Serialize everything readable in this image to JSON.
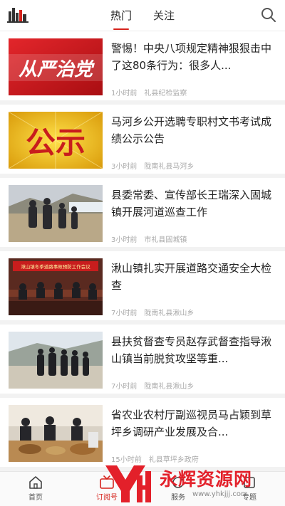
{
  "header": {
    "tabs": [
      {
        "label": "热门",
        "active": true
      },
      {
        "label": "关注",
        "active": false
      }
    ],
    "logo_icon": "city-skyline-icon",
    "search_icon": "search-icon",
    "accent_color": "#d6221b"
  },
  "articles": [
    {
      "title": "警惕！中央八项规定精神狠狠击中了这80条行为：很多人...",
      "time": "1小时前",
      "source": "礼县纪检监察",
      "thumb_text": "从严治党"
    },
    {
      "title": "马河乡公开选聘专职村文书考试成绩公示公告",
      "time": "3小时前",
      "source": "陇南礼县马河乡",
      "thumb_text": "公示"
    },
    {
      "title": "县委常委、宣传部长王瑞深入固城镇开展河道巡查工作",
      "time": "3小时前",
      "source": "市礼县固城镇",
      "thumb_text": ""
    },
    {
      "title": "湫山镇扎实开展道路交通安全大检查",
      "time": "7小时前",
      "source": "陇南礼县湫山乡",
      "thumb_text": "湫山镇冬季道路事故预防工作会议"
    },
    {
      "title": "县扶贫督查专员赵存武督查指导湫山镇当前脱贫攻坚等重...",
      "time": "7小时前",
      "source": "陇南礼县湫山乡",
      "thumb_text": ""
    },
    {
      "title": "省农业农村厅副巡视员马占颖到草坪乡调研产业发展及合...",
      "time": "15小时前",
      "source": "礼县草坪乡政府",
      "thumb_text": ""
    }
  ],
  "bottom_nav": [
    {
      "label": "首页",
      "icon": "home-icon",
      "active": false
    },
    {
      "label": "订阅号",
      "icon": "tv-icon",
      "active": true
    },
    {
      "label": "服务",
      "icon": "service-icon",
      "active": false
    },
    {
      "label": "专题",
      "icon": "topic-icon",
      "active": false
    }
  ],
  "watermark": {
    "text": "永辉资源网",
    "url": "www.yhkjjj.com"
  }
}
